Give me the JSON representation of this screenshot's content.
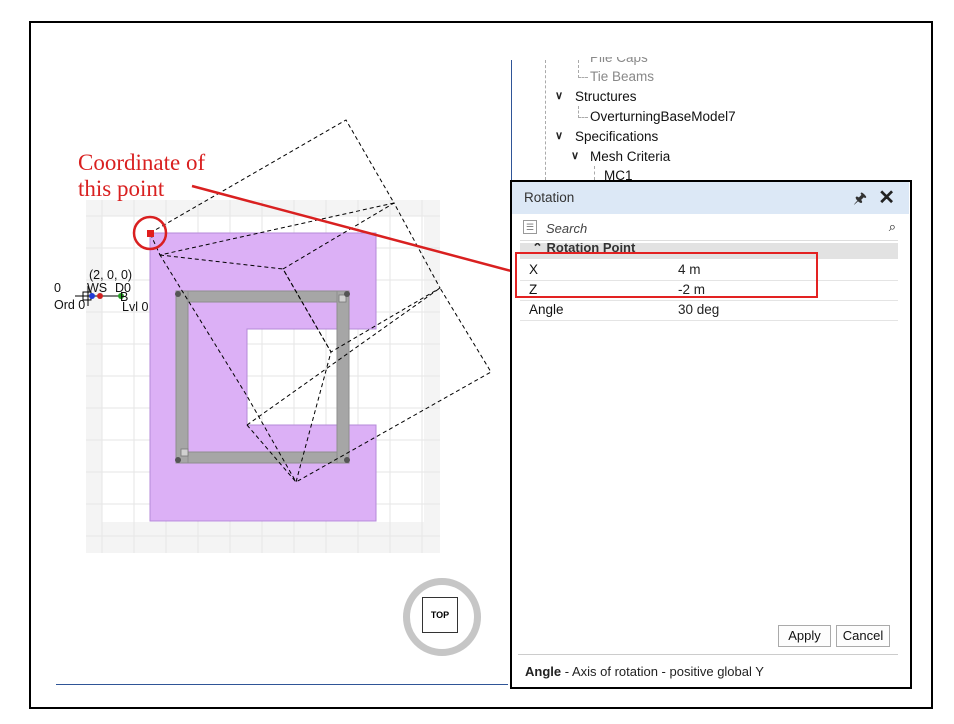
{
  "annotation": {
    "text": "Coordinate of\nthis point",
    "color": "#d92020"
  },
  "viewport_labels": {
    "coord": "(2, 0, 0)",
    "zero": "0",
    "ws": "WS",
    "d0": "D0",
    "b": "B",
    "ord": "Ord 0",
    "lvl": "Lvl 0"
  },
  "tree": {
    "pile_caps": "Pile Caps",
    "tie_beams": "Tie Beams",
    "structures": "Structures",
    "model": "OverturningBaseModel7",
    "specifications": "Specifications",
    "mesh_criteria": "Mesh Criteria",
    "mc1": "MC1"
  },
  "nav_cube": {
    "label": "TOP"
  },
  "panel": {
    "title": "Rotation",
    "search_placeholder": "Search",
    "category": "Rotation Point",
    "properties": [
      {
        "name": "X",
        "value": "4 m"
      },
      {
        "name": "Z",
        "value": "-2 m"
      },
      {
        "name": "Angle",
        "value": "30 deg"
      }
    ],
    "apply_label": "Apply",
    "cancel_label": "Cancel",
    "description_title": "Angle",
    "description_text": " - Axis of rotation - positive global Y"
  },
  "colors": {
    "slab": "#dcb0f6",
    "beam": "#a0a0a0",
    "highlight": "#e32222",
    "panel_header": "#dce8f6"
  }
}
